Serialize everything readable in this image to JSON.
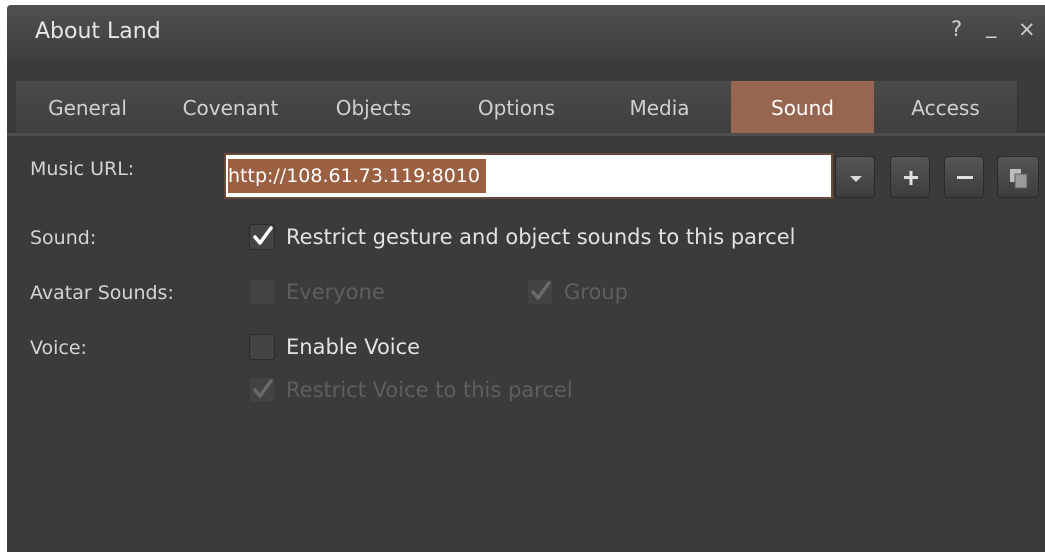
{
  "window": {
    "title": "About Land",
    "help": "?",
    "minimize": "_",
    "close": "×"
  },
  "tabs": [
    {
      "label": "General"
    },
    {
      "label": "Covenant"
    },
    {
      "label": "Objects"
    },
    {
      "label": "Options"
    },
    {
      "label": "Media"
    },
    {
      "label": "Sound",
      "active": true
    },
    {
      "label": "Access"
    }
  ],
  "music": {
    "label": "Music URL:",
    "value": "http://108.61.73.119:8010",
    "buttons": [
      "dropdown-arrow-icon",
      "plus-icon",
      "minus-icon",
      "copy-icon"
    ]
  },
  "sound": {
    "label": "Sound:",
    "restrict_label": "Restrict gesture and object sounds to this parcel",
    "restrict_checked": true
  },
  "avatar_sounds": {
    "label": "Avatar Sounds:",
    "everyone_label": "Everyone",
    "everyone_checked": false,
    "group_label": "Group",
    "group_checked": true
  },
  "voice": {
    "label": "Voice:",
    "enable_label": "Enable Voice",
    "enable_checked": false,
    "restrict_label": "Restrict Voice to this parcel",
    "restrict_checked": true
  },
  "colors": {
    "active_tab": "#976650",
    "selection": "#9b5f42",
    "panel": "#3b3b3b"
  }
}
